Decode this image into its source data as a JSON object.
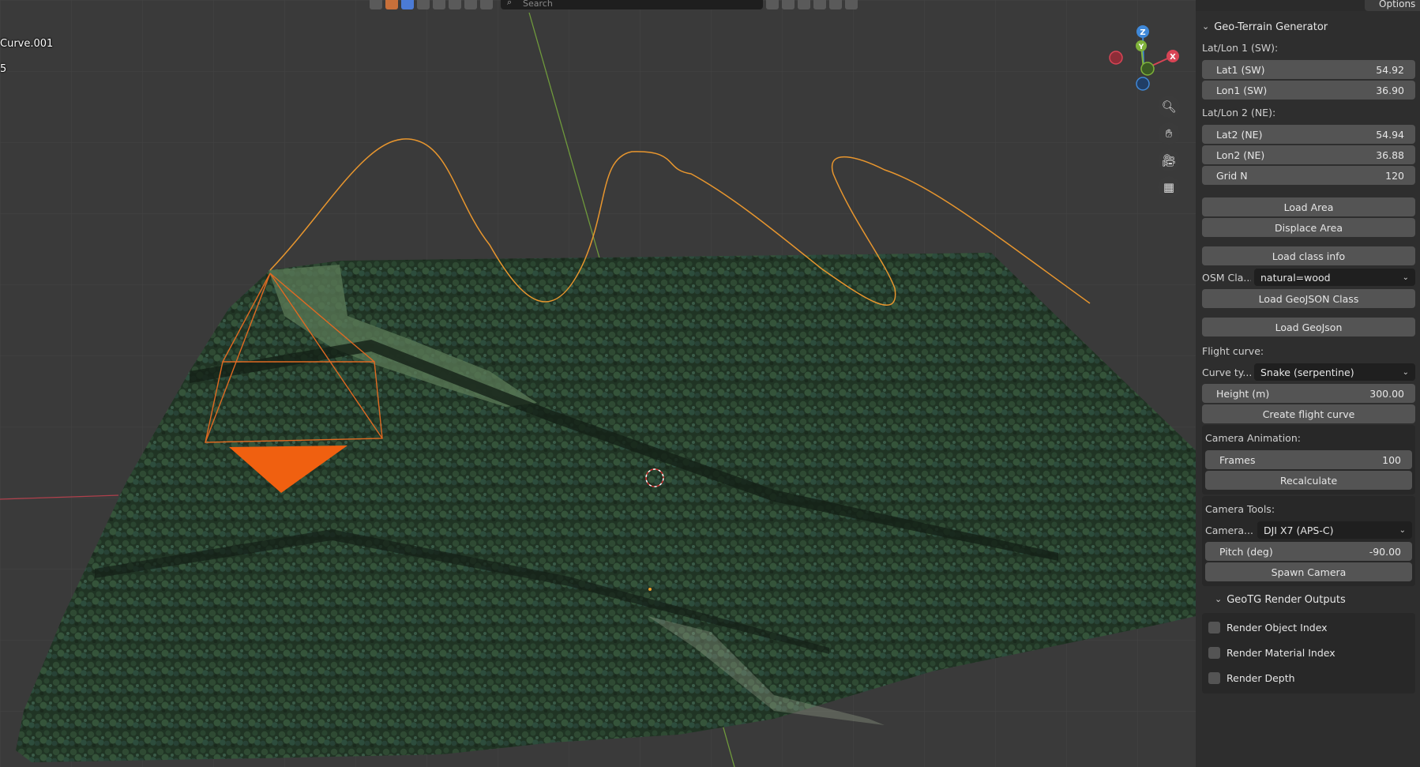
{
  "viewport": {
    "object_name": "Curve.001",
    "object_count": "5",
    "search_placeholder": "Search",
    "gizmo": {
      "z": "Z",
      "y": "Y",
      "x": "X"
    },
    "nav_icons": [
      "zoom-icon",
      "hand-pan-icon",
      "camera-icon",
      "grid-perspective-icon"
    ]
  },
  "options_label": "Options",
  "panel": {
    "title": "Geo-Terrain Generator",
    "sw_label": "Lat/Lon 1 (SW):",
    "lat1": {
      "label": "Lat1 (SW)",
      "value": "54.92"
    },
    "lon1": {
      "label": "Lon1 (SW)",
      "value": "36.90"
    },
    "ne_label": "Lat/Lon 2 (NE):",
    "lat2": {
      "label": "Lat2 (NE)",
      "value": "54.94"
    },
    "lon2": {
      "label": "Lon2 (NE)",
      "value": "36.88"
    },
    "gridn": {
      "label": "Grid N",
      "value": "120"
    },
    "load_area": "Load Area",
    "displace_area": "Displace Area",
    "load_class_info": "Load class info",
    "osm_class": {
      "label": "OSM Cla...",
      "value": "natural=wood"
    },
    "load_geojson_class": "Load GeoJSON Class",
    "load_geojson": "Load GeoJson",
    "flight_curve_label": "Flight curve:",
    "curve_type": {
      "label": "Curve ty...",
      "value": "Snake (serpentine)"
    },
    "height": {
      "label": "Height (m)",
      "value": "300.00"
    },
    "create_flight_curve": "Create flight curve",
    "camera_animation_label": "Camera Animation:",
    "frames": {
      "label": "Frames",
      "value": "100"
    },
    "recalculate": "Recalculate",
    "camera_tools_label": "Camera Tools:",
    "camera_select": {
      "label": "Camera...",
      "value": "DJI X7 (APS-C)"
    },
    "pitch": {
      "label": "Pitch (deg)",
      "value": "-90.00"
    },
    "spawn_camera": "Spawn Camera",
    "render_outputs_title": "GeoTG Render Outputs",
    "render_object_index": "Render Object Index",
    "render_material_index": "Render Material Index",
    "render_depth": "Render Depth"
  },
  "colors": {
    "panel_bg": "#2e2e2e",
    "field_bg": "#545454",
    "curve_orange": "#e8962e",
    "camera_orange": "#f06010",
    "forest_dark": "#1f3322",
    "axis_x": "#d84455",
    "axis_y": "#7fb23a",
    "axis_z": "#3f88d8"
  }
}
